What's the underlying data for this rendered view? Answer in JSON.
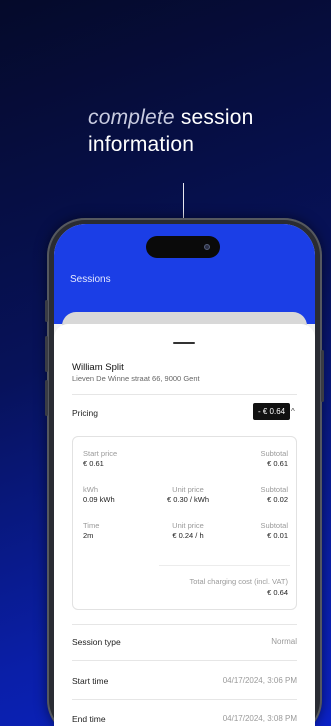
{
  "headline": {
    "accent_word": "complete",
    "line1_rest": " session",
    "line2": "information"
  },
  "app": {
    "title": "Sessions"
  },
  "session": {
    "name": "William Split",
    "address": "Lieven De Winne straat 66, 9000 Gent"
  },
  "pricing": {
    "label": "Pricing",
    "badge": "- € 0.64",
    "expanded_icon": "chevron-up-icon",
    "start_price": {
      "label": "Start price",
      "value": "€ 0.61",
      "subtotal_label": "Subtotal",
      "subtotal": "€ 0.61"
    },
    "kwh": {
      "label": "kWh",
      "value": "0.09 kWh",
      "unit_label": "Unit price",
      "unit_price": "€ 0.30 / kWh",
      "subtotal_label": "Subtotal",
      "subtotal": "€ 0.02"
    },
    "time": {
      "label": "Time",
      "value": "2m",
      "unit_label": "Unit price",
      "unit_price": "€ 0.24 / h",
      "subtotal_label": "Subtotal",
      "subtotal": "€ 0.01"
    },
    "total": {
      "label": "Total charging cost (incl. VAT)",
      "value": "€ 0.64"
    }
  },
  "details": [
    {
      "label": "Session type",
      "value": "Normal"
    },
    {
      "label": "Start time",
      "value": "04/17/2024, 3:06 PM"
    },
    {
      "label": "End time",
      "value": "04/17/2024, 3:08 PM"
    }
  ],
  "colors": {
    "app_bar": "#1b3ee6",
    "background_dark": "#050a2a",
    "background_bright": "#0b22c8"
  }
}
